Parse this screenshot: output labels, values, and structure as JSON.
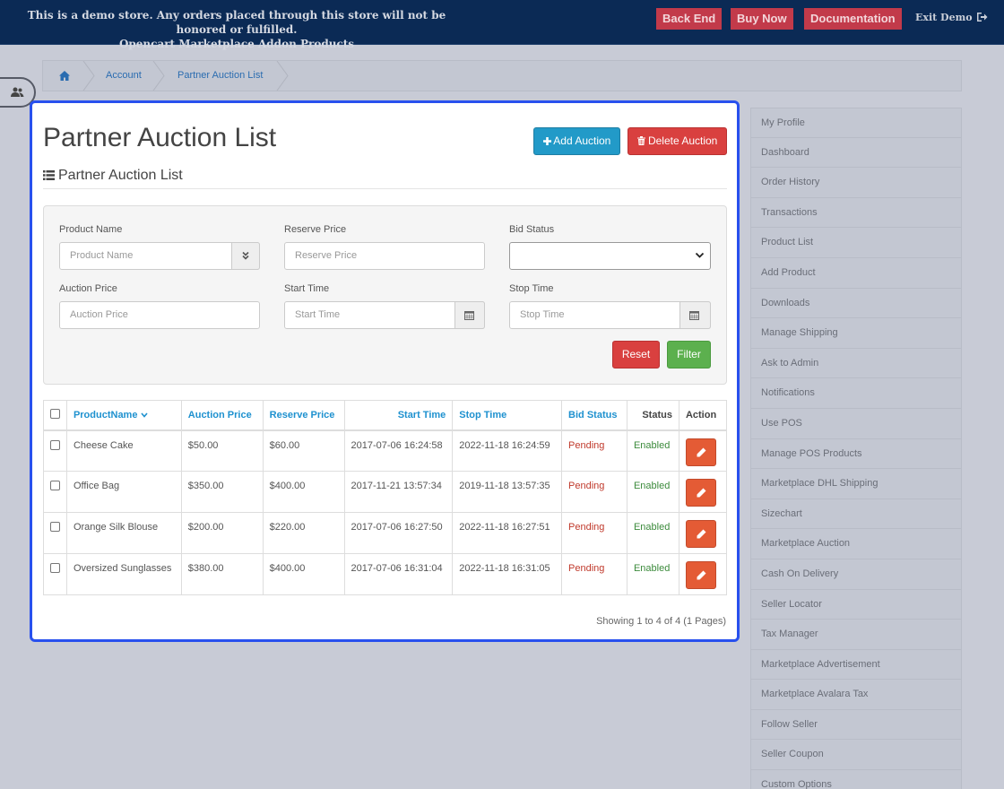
{
  "topbar": {
    "notice_line1": "This is a demo store. Any orders placed through this store will not be honored or fulfilled.",
    "notice_line2": "Opencart Marketplace Addon Products",
    "buttons": [
      "Back End",
      "Buy Now",
      "Documentation"
    ],
    "exit": "Exit Demo"
  },
  "breadcrumb": [
    "home",
    "Account",
    "Partner Auction List"
  ],
  "page": {
    "title": "Partner Auction List",
    "subtitle": "Partner Auction List",
    "add_button": "Add Auction",
    "delete_button": "Delete Auction"
  },
  "filter": {
    "product_name": {
      "label": "Product Name",
      "placeholder": "Product Name"
    },
    "reserve_price": {
      "label": "Reserve Price",
      "placeholder": "Reserve Price"
    },
    "bid_status": {
      "label": "Bid Status",
      "value": ""
    },
    "auction_price": {
      "label": "Auction Price",
      "placeholder": "Auction Price"
    },
    "start_time": {
      "label": "Start Time",
      "placeholder": "Start Time"
    },
    "stop_time": {
      "label": "Stop Time",
      "placeholder": "Stop Time"
    },
    "reset": "Reset",
    "filter": "Filter"
  },
  "table": {
    "headers": [
      "ProductName",
      "Auction Price",
      "Reserve Price",
      "Start Time",
      "Stop Time",
      "Bid Status",
      "Status",
      "Action"
    ],
    "rows": [
      [
        "Cheese Cake",
        "$50.00",
        "$60.00",
        "2017-07-06 16:24:58",
        "2022-11-18 16:24:59",
        "Pending",
        "Enabled"
      ],
      [
        "Office Bag",
        "$350.00",
        "$400.00",
        "2017-11-21 13:57:34",
        "2019-11-18 13:57:35",
        "Pending",
        "Enabled"
      ],
      [
        "Orange Silk Blouse",
        "$200.00",
        "$220.00",
        "2017-07-06 16:27:50",
        "2022-11-18 16:27:51",
        "Pending",
        "Enabled"
      ],
      [
        "Oversized Sunglasses",
        "$380.00",
        "$400.00",
        "2017-07-06 16:31:04",
        "2022-11-18 16:31:05",
        "Pending",
        "Enabled"
      ]
    ],
    "showing": "Showing 1 to 4 of 4 (1 Pages)"
  },
  "menu": [
    "My Profile",
    "Dashboard",
    "Order History",
    "Transactions",
    "Product List",
    "Add Product",
    "Downloads",
    "Manage Shipping",
    "Ask to Admin",
    "Notifications",
    "Use POS",
    "Manage POS Products",
    "Marketplace DHL Shipping",
    "Sizechart",
    "Marketplace Auction",
    "Cash On Delivery",
    "Seller Locator",
    "Tax Manager",
    "Marketplace Advertisement",
    "Marketplace Avalara Tax",
    "Follow Seller",
    "Seller Coupon",
    "Custom Options"
  ],
  "colors": {
    "accent": "#1e91cf",
    "danger": "#d9403f",
    "success": "#5cb04e",
    "panel_border": "#2850ee",
    "topbar": "#0b2a55"
  }
}
